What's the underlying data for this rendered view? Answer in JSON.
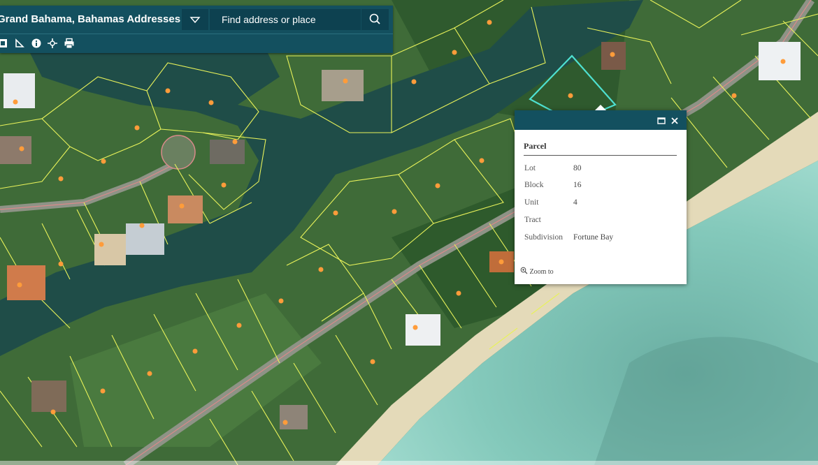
{
  "header": {
    "title": "Grand Bahama, Bahamas Addresses",
    "search_placeholder": "Find address or place",
    "dropdown_icon": "chevron-down-icon",
    "search_icon": "search-icon",
    "tools": [
      "layers-icon",
      "measure-icon",
      "info-icon",
      "locate-icon",
      "print-icon"
    ]
  },
  "popup": {
    "title": "Parcel",
    "maximize_icon": "maximize-icon",
    "close_icon": "close-icon",
    "attributes": [
      {
        "label": "Lot",
        "value": "80"
      },
      {
        "label": "Block",
        "value": "16"
      },
      {
        "label": "Unit",
        "value": "4"
      },
      {
        "label": "Tract",
        "value": ""
      },
      {
        "label": "Subdivision",
        "value": "Fortune Bay"
      }
    ],
    "zoom_label": "Zoom to",
    "zoom_icon": "zoom-in-icon"
  },
  "map": {
    "colors": {
      "land": "#3d6a37",
      "canal": "#1d4d47",
      "sea": "#7cc2b4",
      "beach": "#e6dcbf",
      "parcel_line": "#e8f25a",
      "road": "#8f9389",
      "selected": "#4ee0d0",
      "marker": "#ff9c3a"
    }
  }
}
